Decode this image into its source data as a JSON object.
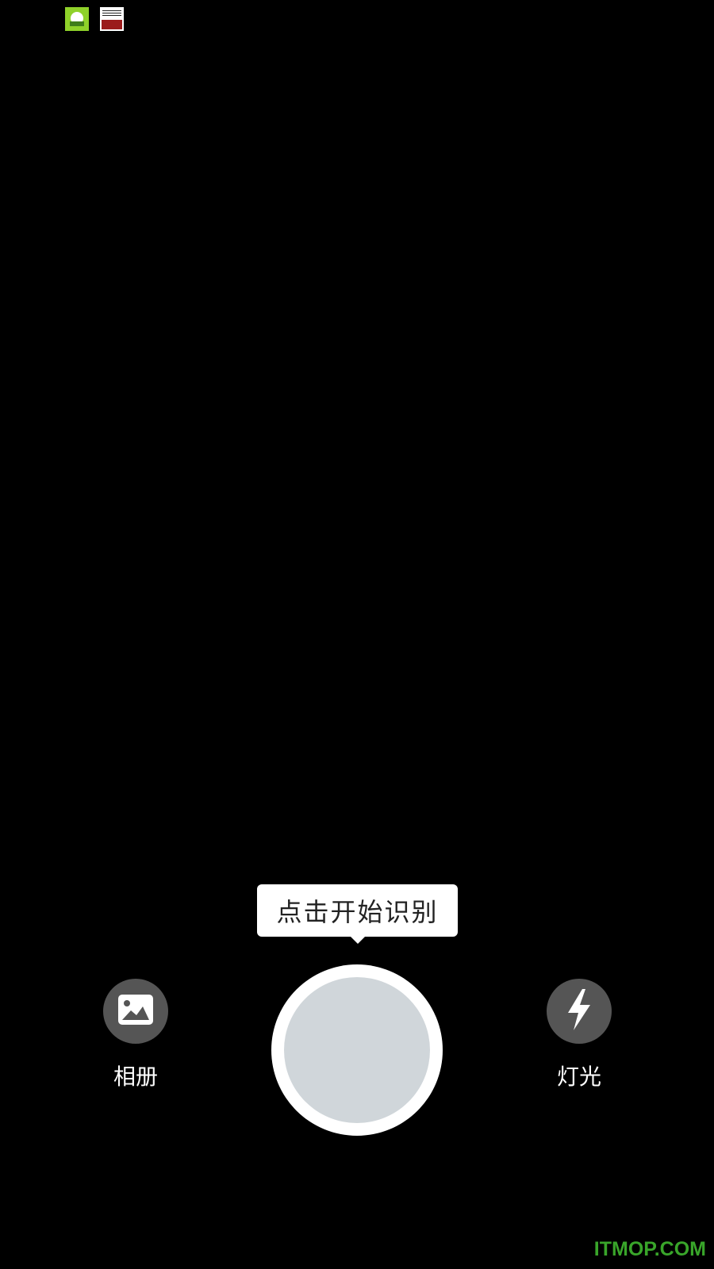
{
  "status_bar": {
    "icons": [
      "app-mascot-icon",
      "news-app-icon"
    ]
  },
  "hint": {
    "text": "点击开始识别"
  },
  "controls": {
    "album_label": "相册",
    "album_icon": "image-icon",
    "light_label": "灯光",
    "light_icon": "flash-icon",
    "shutter_icon": "shutter-button"
  },
  "colors": {
    "background": "#000000",
    "button_bg": "#555555",
    "shutter_inner": "#d0d6da",
    "watermark": "#39a52a"
  },
  "watermark": {
    "text": "ITMOP.COM"
  }
}
